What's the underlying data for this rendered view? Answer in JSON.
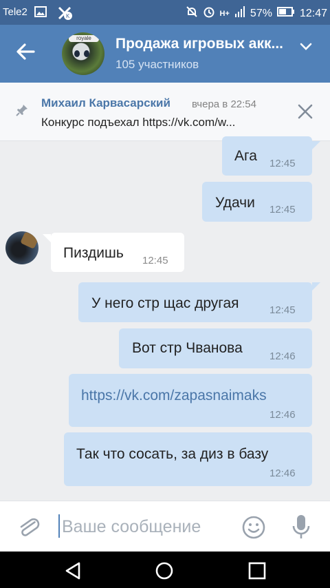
{
  "status_bar": {
    "carrier": "Tele2",
    "network": "H+",
    "battery": "57%",
    "time": "12:47"
  },
  "header": {
    "title": "Продажа игровых акк...",
    "subtitle": "105 участников",
    "avatar_label": "royale"
  },
  "pinned": {
    "author": "Михаил Карвасарский",
    "time": "вчера в 22:54",
    "text": "Конкурс подъехал https://vk.com/w..."
  },
  "messages": [
    {
      "direction": "out",
      "text": "Ага",
      "time": "12:45"
    },
    {
      "direction": "out",
      "text": "Удачи",
      "time": "12:45"
    },
    {
      "direction": "in",
      "text": "Пиздишь",
      "time": "12:45"
    },
    {
      "direction": "out",
      "text": "У него стр щас другая",
      "time": "12:45"
    },
    {
      "direction": "out",
      "text": "Вот стр Чванова",
      "time": "12:46"
    },
    {
      "direction": "out",
      "text": "https://vk.com/zapasnaimaks",
      "time": "12:46"
    },
    {
      "direction": "out",
      "text": "Так что сосать, за диз в базу",
      "time": "12:46"
    }
  ],
  "composer": {
    "placeholder": "Ваше сообщение"
  },
  "colors": {
    "header": "#5181b8",
    "status_bar": "#3f6595",
    "outgoing_bubble": "#cce0f5",
    "incoming_bubble": "#ffffff",
    "link": "#4a76a8"
  }
}
